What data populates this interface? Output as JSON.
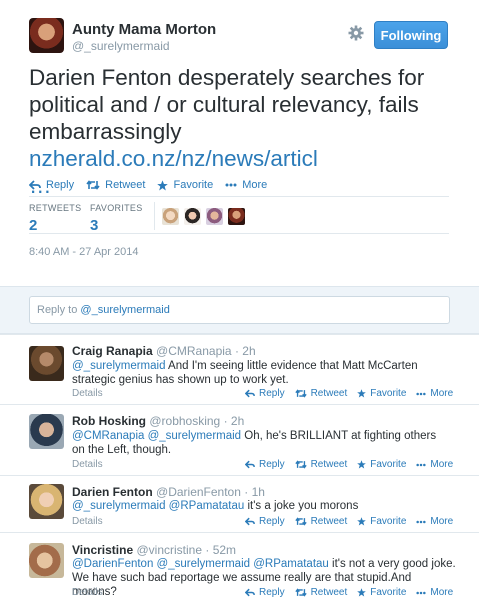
{
  "main_tweet": {
    "fullname": "Aunty Mama Morton",
    "username": "@_surelymermaid",
    "follow_label": "Following",
    "text_part1": "Darien Fenton desperately searches for political and / or cultural relevancy, fails embarrassingly ",
    "link": "nzherald.co.nz/nz/news/articl",
    "ellipsis": "…",
    "actions": {
      "reply": "Reply",
      "retweet": "Retweet",
      "favorite": "Favorite",
      "more": "More"
    },
    "stats": {
      "retweets_label": "RETWEETS",
      "retweets": "2",
      "favorites_label": "FAVORITES",
      "favorites": "3"
    },
    "timestamp": "8:40 AM - 27 Apr 2014"
  },
  "reply_box": {
    "prefix": "Reply to ",
    "mention": "@_surelymermaid"
  },
  "replies": [
    {
      "name": "Craig Ranapia",
      "user": "@CMRanapia",
      "time": "· 2h",
      "mention": "@_surelymermaid",
      "text": " And I'm seeing little evidence that Matt McCarten strategic genius has shown up to work yet."
    },
    {
      "name": "Rob Hosking",
      "user": "@robhosking",
      "time": "· 2h",
      "mention": "@CMRanapia @_surelymermaid",
      "text": "  Oh, he's BRILLIANT at fighting others on the Left, though."
    },
    {
      "name": "Darien Fenton",
      "user": "@DarienFenton",
      "time": "· 1h",
      "mention": "@_surelymermaid @RPamatatau",
      "text": " it's a joke you morons"
    },
    {
      "name": "Vincristine",
      "user": "@vincristine",
      "time": "· 52m",
      "mention": "@DarienFenton @_surelymermaid @RPamatatau",
      "text": " it's not a very good joke. We have such bad reportage we assume really are that stupid.And morons?"
    }
  ],
  "reply_actions": {
    "details": "Details",
    "reply": "Reply",
    "retweet": "Retweet",
    "favorite": "Favorite",
    "more": "More"
  },
  "colors": {
    "link": "#2b7bb9",
    "follow_button": "#4ba3ea",
    "reply_bg": "#eef4f9"
  }
}
